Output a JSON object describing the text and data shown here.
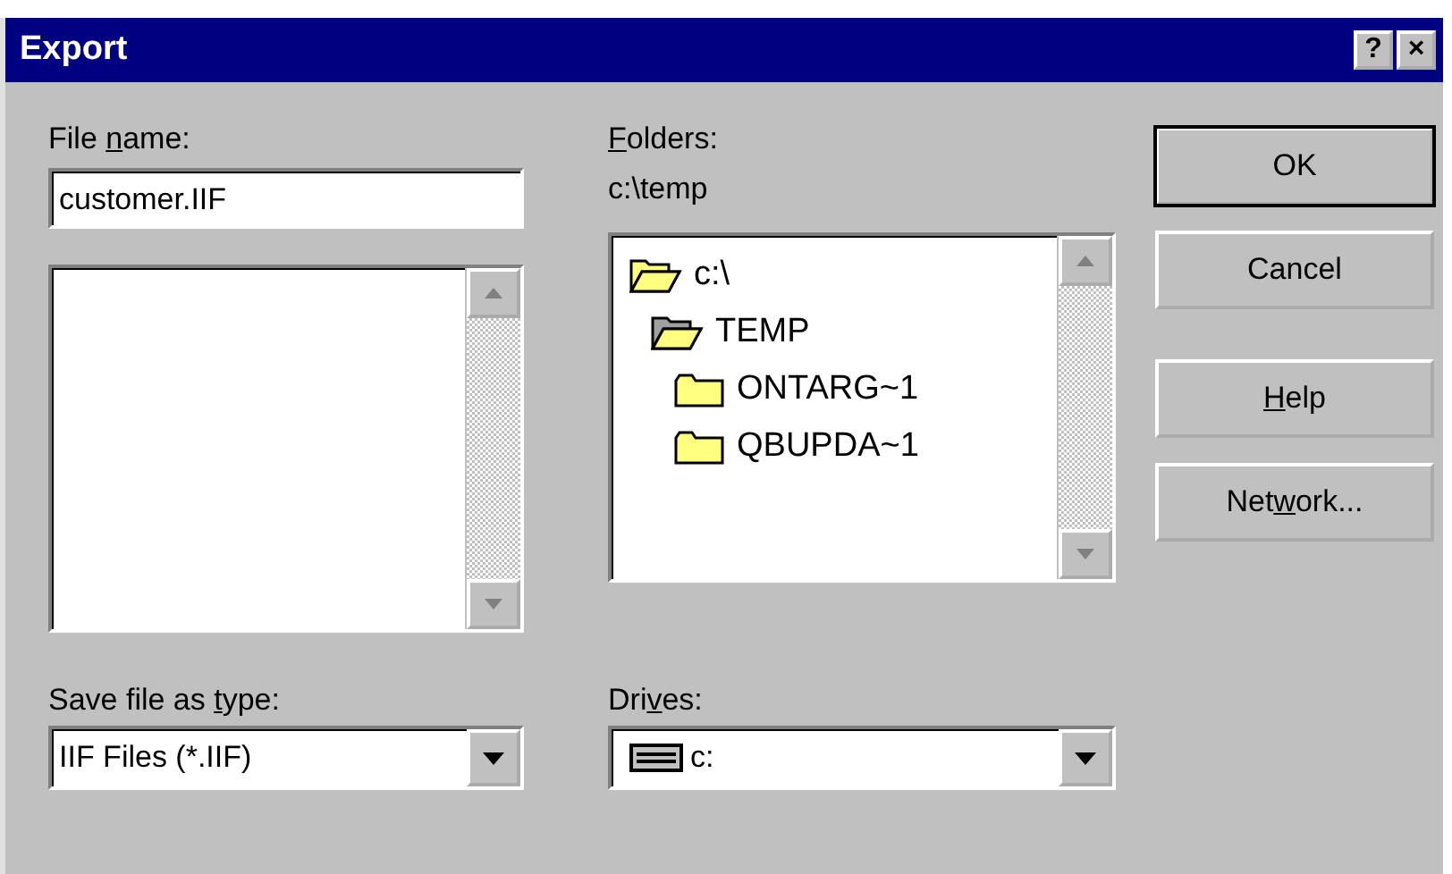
{
  "window": {
    "title": "Export",
    "title_buttons": [
      "?",
      "×"
    ]
  },
  "file_name": {
    "label": {
      "pre": "File ",
      "key": "n",
      "post": "ame:"
    },
    "value": "customer.IIF"
  },
  "save_type": {
    "label": {
      "pre": "Save file as ",
      "key": "t",
      "post": "ype:"
    },
    "value": "IIF Files (*.IIF)"
  },
  "folders": {
    "label": {
      "key": "F",
      "post": "olders:"
    },
    "path": "c:\\temp",
    "tree": [
      {
        "name": "c:\\",
        "open": true,
        "children": [
          {
            "name": "TEMP",
            "open": true,
            "children": [
              {
                "name": "ONTARG~1",
                "open": false
              },
              {
                "name": "QBUPDA~1",
                "open": false
              }
            ]
          }
        ]
      }
    ]
  },
  "drives": {
    "label": {
      "pre": "Dri",
      "key": "v",
      "post": "es:"
    },
    "value": "c:"
  },
  "buttons": [
    {
      "label": {
        "pre": "OK"
      },
      "default": true
    },
    {
      "label": {
        "pre": "Cancel"
      },
      "default": false
    },
    {
      "label": {
        "key": "H",
        "post": "elp"
      },
      "default": false
    },
    {
      "label": {
        "pre": "Net",
        "key": "w",
        "post": "ork..."
      },
      "default": false
    }
  ]
}
